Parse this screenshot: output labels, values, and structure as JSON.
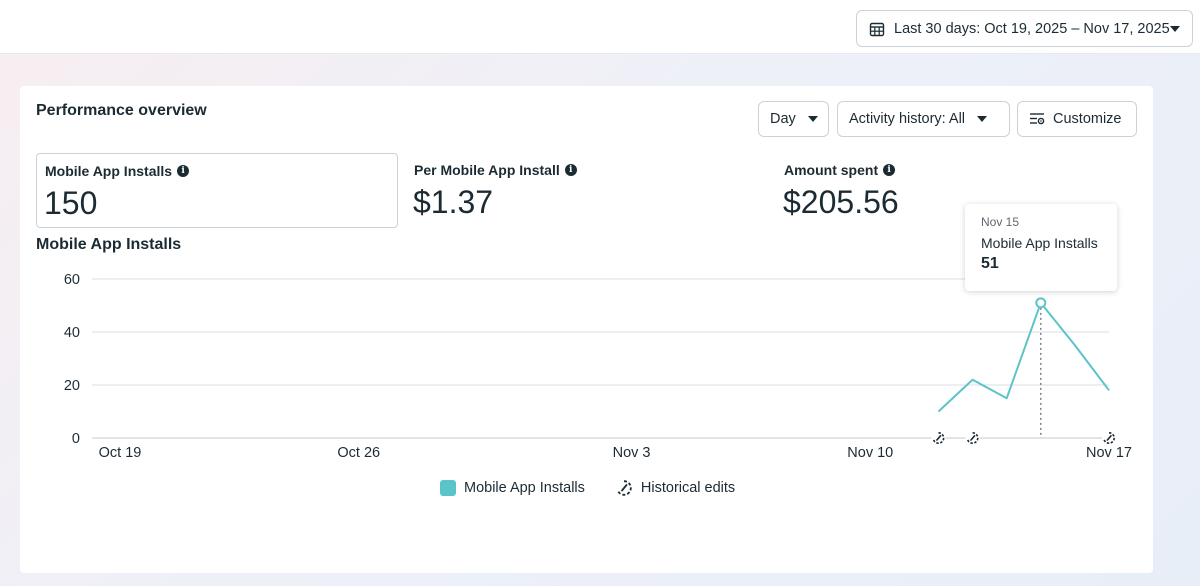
{
  "date_range": {
    "label": "Last 30 days: Oct 19, 2025 – Nov 17, 2025"
  },
  "panel": {
    "title": "Performance overview",
    "controls": {
      "day": "Day",
      "activity": "Activity history: All",
      "customize": "Customize"
    }
  },
  "metrics": [
    {
      "label": "Mobile App Installs",
      "value": "150"
    },
    {
      "label": "Per Mobile App Install",
      "value": "$1.37"
    },
    {
      "label": "Amount spent",
      "value": "$205.56"
    }
  ],
  "chart_title": "Mobile App Installs",
  "tooltip": {
    "date": "Nov 15",
    "series": "Mobile App Installs",
    "value": "51"
  },
  "legend": {
    "series": "Mobile App Installs",
    "edits": "Historical edits"
  },
  "colors": {
    "series": "#5bc4c9",
    "grid": "#dadde1",
    "axis_text": "#1c2b33"
  },
  "chart_data": {
    "type": "line",
    "title": "",
    "xlabel": "",
    "ylabel": "",
    "ylim": [
      0,
      60
    ],
    "yticks": [
      0,
      20,
      40,
      60
    ],
    "x_range": [
      "Oct 19",
      "Nov 17"
    ],
    "xticks": [
      "Oct 19",
      "Oct 26",
      "Nov 3",
      "Nov 10",
      "Nov 17"
    ],
    "series": [
      {
        "name": "Mobile App Installs",
        "x": [
          "Nov 12",
          "Nov 13",
          "Nov 14",
          "Nov 15",
          "Nov 16",
          "Nov 17"
        ],
        "values": [
          10,
          22,
          15,
          51,
          35,
          18
        ]
      }
    ],
    "historical_edits": [
      "Nov 12",
      "Nov 13",
      "Nov 17"
    ],
    "highlight": {
      "x": "Nov 15",
      "value": 51
    },
    "grid": true,
    "legend_position": "bottom"
  }
}
